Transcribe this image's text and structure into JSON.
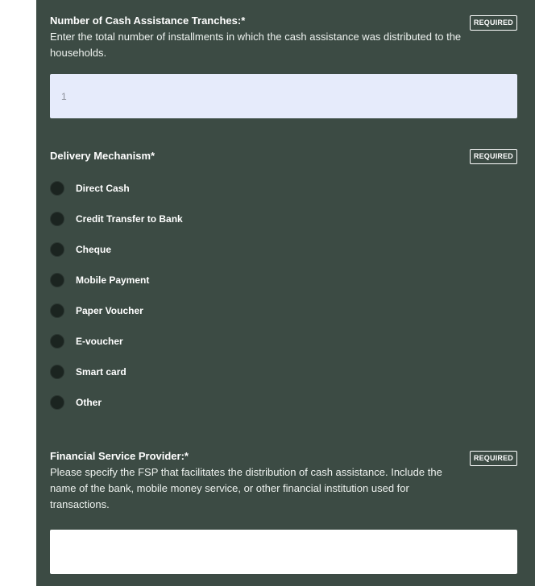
{
  "questions": {
    "tranches": {
      "label": "Number of Cash Assistance Tranches:*",
      "hint": "Enter the total number of installments in which the cash assistance was distributed to the households.",
      "badge": "REQUIRED",
      "value": "1"
    },
    "delivery": {
      "label": "Delivery Mechanism*",
      "badge": "REQUIRED",
      "options": [
        "Direct Cash",
        "Credit Transfer to Bank",
        "Cheque",
        "Mobile Payment",
        "Paper Voucher",
        "E-voucher",
        "Smart card",
        "Other"
      ]
    },
    "fsp": {
      "label": "Financial Service Provider:*",
      "hint": "Please specify the FSP that facilitates the distribution of cash assistance. Include the name of the bank, mobile money service, or other financial institution used for transactions.",
      "badge": "REQUIRED",
      "value": ""
    }
  },
  "colors": {
    "panel_background": "#3c4b44",
    "filled_input_background": "#e6ebfb",
    "radio_fill": "#1b2420"
  }
}
